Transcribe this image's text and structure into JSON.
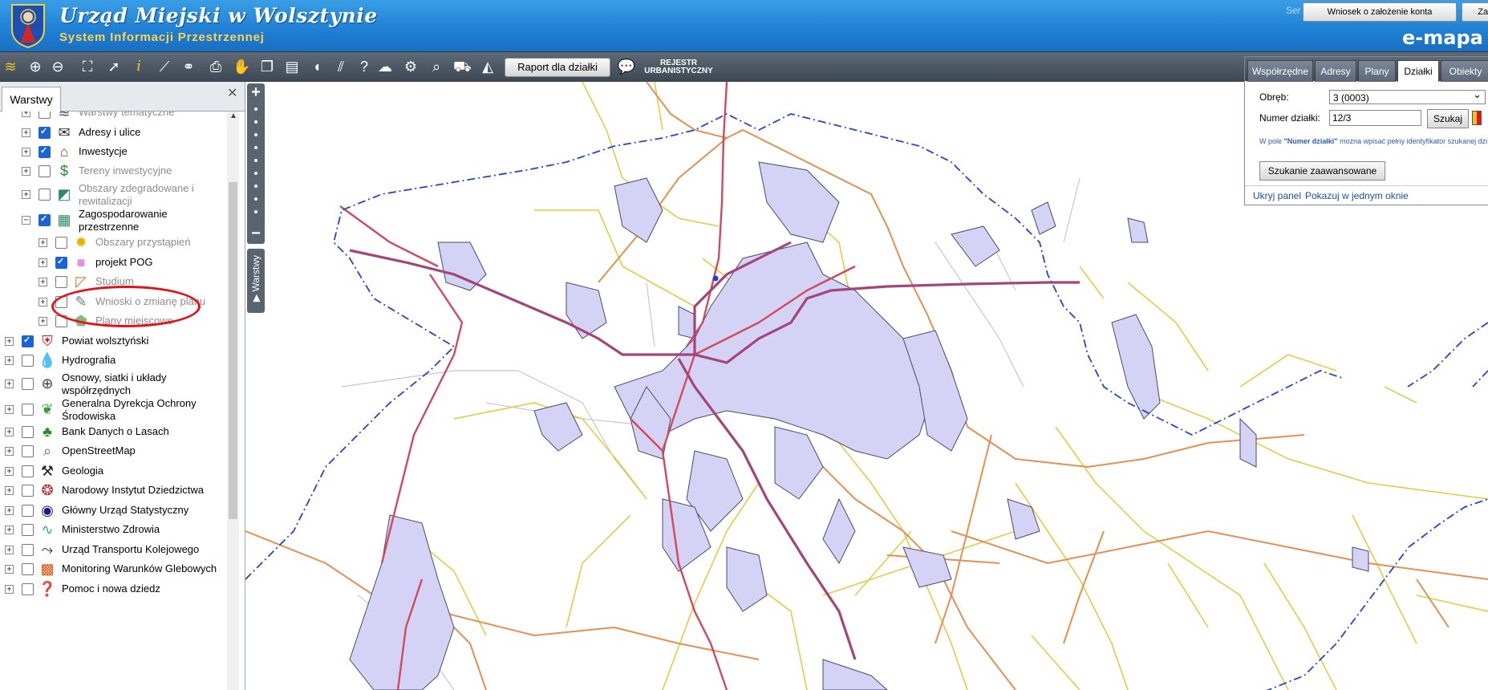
{
  "header": {
    "title": "Urząd Miejski w Wolsztynie",
    "subtitle": "System Informacji Przestrzennej",
    "ser_text": "Ser",
    "btn_wniosek": "Wniosek o założenie konta",
    "btn_zal": "Zalo",
    "brand": "e-mapa"
  },
  "toolbar": {
    "raport": "Raport dla działki",
    "rejestr_line1": "REJESTR",
    "rejestr_line2": "URBANISTYCZNY",
    "icons": [
      "layers-icon",
      "zoom-in-icon",
      "zoom-out-icon",
      "zoom-extent-icon",
      "pointer-icon",
      "info-icon",
      "measure-icon",
      "link-icon",
      "print-icon",
      "pan-icon",
      "copy-icon",
      "layout-icon",
      "comment-icon",
      "hatch-icon",
      "help-icon",
      "cloud-upload-icon",
      "settings-icon",
      "search-icon",
      "cart-icon",
      "warning-icon"
    ]
  },
  "panel": {
    "tab": "Warstwy",
    "close": "✕"
  },
  "tree": [
    {
      "label": "Warstwy tematyczne",
      "level": 1,
      "checked": false,
      "dim": true,
      "icon": "stack-icon"
    },
    {
      "label": "Adresy i ulice",
      "level": 1,
      "checked": true,
      "dim": false,
      "icon": "envelope-icon"
    },
    {
      "label": "Inwestycje",
      "level": 1,
      "checked": true,
      "dim": false,
      "icon": "building-icon"
    },
    {
      "label": "Tereny inwestycyjne",
      "level": 1,
      "checked": false,
      "dim": true,
      "icon": "dollar-icon"
    },
    {
      "label": "Obszary zdegradowane i",
      "label2": "rewitalizacji",
      "level": 1,
      "checked": false,
      "dim": true,
      "icon": "split-square-icon"
    },
    {
      "label": "Zagospodarowanie",
      "label2": "przestrzenne",
      "level": 1,
      "checked": true,
      "dim": false,
      "icon": "city-plan-icon",
      "expanded": true
    },
    {
      "label": "Obszary przystąpień",
      "level": 2,
      "checked": false,
      "dim": true,
      "icon": "sun-icon"
    },
    {
      "label": "projekt POG",
      "level": 2,
      "checked": true,
      "dim": false,
      "icon": "pink-square-icon"
    },
    {
      "label": "Studium",
      "level": 2,
      "checked": false,
      "dim": true,
      "icon": "study-icon"
    },
    {
      "label": "Wnioski o zmianę planu",
      "level": 2,
      "checked": false,
      "dim": true,
      "icon": "document-icon"
    },
    {
      "label": "Plany miejscowe",
      "level": 2,
      "checked": false,
      "dim": true,
      "icon": "map-polygon-icon"
    },
    {
      "label": "Powiat wolsztyński",
      "level": 0,
      "checked": true,
      "dim": false,
      "icon": "coat-of-arms-icon"
    },
    {
      "label": "Hydrografia",
      "level": 0,
      "checked": false,
      "dim": false,
      "icon": "water-drop-icon"
    },
    {
      "label": "Osnowy, siatki i układy",
      "label2": "współrzędnych",
      "level": 0,
      "checked": false,
      "dim": false,
      "icon": "globe-icon"
    },
    {
      "label": "Generalna Dyrekcja Ochrony",
      "label2": "Środowiska",
      "level": 0,
      "checked": false,
      "dim": false,
      "icon": "leaf-icon"
    },
    {
      "label": "Bank Danych o Lasach",
      "level": 0,
      "checked": false,
      "dim": false,
      "icon": "tree-icon"
    },
    {
      "label": "OpenStreetMap",
      "level": 0,
      "checked": false,
      "dim": false,
      "icon": "magnifier-map-icon"
    },
    {
      "label": "Geologia",
      "level": 0,
      "checked": false,
      "dim": false,
      "icon": "pickaxe-icon"
    },
    {
      "label": "Narodowy Instytut Dziedzictwa",
      "level": 0,
      "checked": false,
      "dim": false,
      "icon": "heritage-icon"
    },
    {
      "label": "Główny Urząd Statystyczny",
      "level": 0,
      "checked": false,
      "dim": false,
      "icon": "statistics-icon"
    },
    {
      "label": "Ministerstwo Zdrowia",
      "level": 0,
      "checked": false,
      "dim": false,
      "icon": "pulse-icon"
    },
    {
      "label": "Urząd Transportu Kolejowego",
      "level": 0,
      "checked": false,
      "dim": false,
      "icon": "rail-icon"
    },
    {
      "label": "Monitoring Warunków Glebowych",
      "level": 0,
      "checked": false,
      "dim": false,
      "icon": "heat-icon"
    },
    {
      "label": "Pomoc i nowa dziedz",
      "level": 0,
      "checked": false,
      "dim": false,
      "icon": "help-book-icon"
    }
  ],
  "map_controls": {
    "zoom_in": "+",
    "zoom_out": "−",
    "layers_tab": "▶ Warstwy"
  },
  "search_panel": {
    "tabs": [
      "Współrzędne",
      "Adresy",
      "Plany",
      "Działki",
      "Obiekty"
    ],
    "active_tab": "Działki",
    "obreb_label": "Obręb:",
    "obreb_value": "3 (0003)",
    "numer_label": "Numer działki:",
    "numer_value": "12/3",
    "szukaj": "Szukaj",
    "hint_prefix": "W pole ",
    "hint_bold": "\"Numer działki\"",
    "hint_suffix": " można wpisać pełny identyfikator szukanej dzi",
    "advanced": "Szukanie zaawansowane",
    "hide_panel": "Ukryj panel",
    "one_window": "Pokazuj w jednym oknie"
  },
  "colors": {
    "header_blue": "#1f7fd4",
    "subtitle_gold": "#ffd24a",
    "settlement_fill": "#d4d2f5",
    "boundary": "#2346c8",
    "road_main": "#d04a5a",
    "road_secondary": "#e08a40",
    "road_local": "#e0c640"
  }
}
